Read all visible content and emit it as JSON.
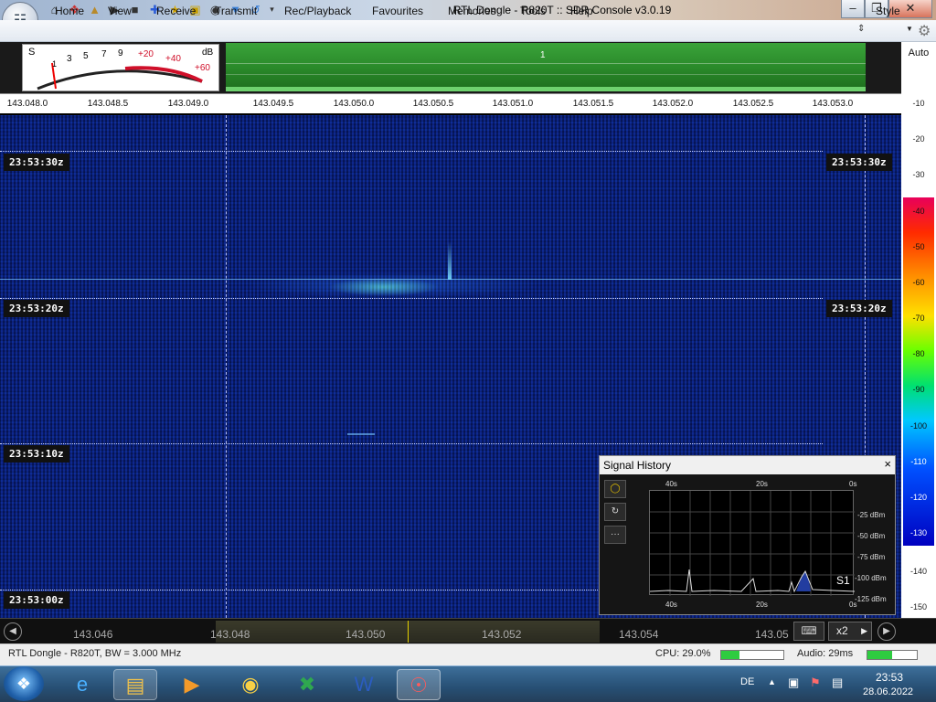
{
  "window": {
    "title": "RTL Dongle - R820T :: SDR Console v3.0.19"
  },
  "colors": {
    "spectrum_green": "#3aa33a",
    "waterfall_blue": "#0a1f80",
    "meter_red": "#d0102a"
  },
  "quick_access": {
    "icons": [
      "home-icon",
      "options-icon",
      "folder-icon",
      "play-icon",
      "stop-icon",
      "plus-icon",
      "star-icon",
      "lock-icon",
      "camera-icon",
      "drop-icon",
      "undo-icon",
      "dropdown-icon"
    ]
  },
  "menu": {
    "items": [
      "Home",
      "View",
      "Receive",
      "Transmit",
      "Rec/Playback",
      "Favourites",
      "Memories",
      "Tools",
      "Help"
    ],
    "style_label": "Style"
  },
  "smeter": {
    "s_label": "S",
    "db_label": "dB",
    "scale": [
      "1",
      "3",
      "5",
      "7",
      "9",
      "+20",
      "+40",
      "+60"
    ]
  },
  "spectrum": {
    "marker_label": "1"
  },
  "freq_scale": [
    "143.048.0",
    "143.048.5",
    "143.049.0",
    "143.049.5",
    "143.050.0",
    "143.050.5",
    "143.051.0",
    "143.051.5",
    "143.052.0",
    "143.052.5",
    "143.053.0"
  ],
  "db_scale": {
    "auto_label": "Auto",
    "ticks": [
      "-10",
      "-20",
      "-30",
      "-40",
      "-50",
      "-60",
      "-70",
      "-80",
      "-90",
      "-100",
      "-110",
      "-120",
      "-130",
      "-140",
      "-150"
    ]
  },
  "waterfall": {
    "timestamps": [
      "23:53:30z",
      "23:53:20z",
      "23:53:10z",
      "23:53:00z"
    ]
  },
  "signal_history": {
    "title": "Signal History",
    "close_label": "×",
    "time_labels": [
      "40s",
      "20s",
      "0s"
    ],
    "dbm_labels": [
      "-25 dBm",
      "-50 dBm",
      "-75 dBm",
      "-100 dBm",
      "-125 dBm"
    ],
    "s_readout": "S1",
    "more_label": "···"
  },
  "bottom_freqs": [
    "143.046",
    "143.048",
    "143.050",
    "143.052",
    "143.054",
    "143.05"
  ],
  "zoom": "x2",
  "status": {
    "device": "RTL Dongle - R820T, BW = 3.000 MHz",
    "cpu": "CPU: 29.0%",
    "cpu_fraction": 0.29,
    "audio": "Audio: 29ms",
    "audio_fraction": 0.5
  },
  "taskbar": {
    "apps": [
      "internet-explorer",
      "file-explorer",
      "media-player",
      "chrome",
      "excel",
      "word",
      "sdr-console"
    ],
    "language": "DE",
    "time": "23:53",
    "date": "28.06.2022"
  }
}
